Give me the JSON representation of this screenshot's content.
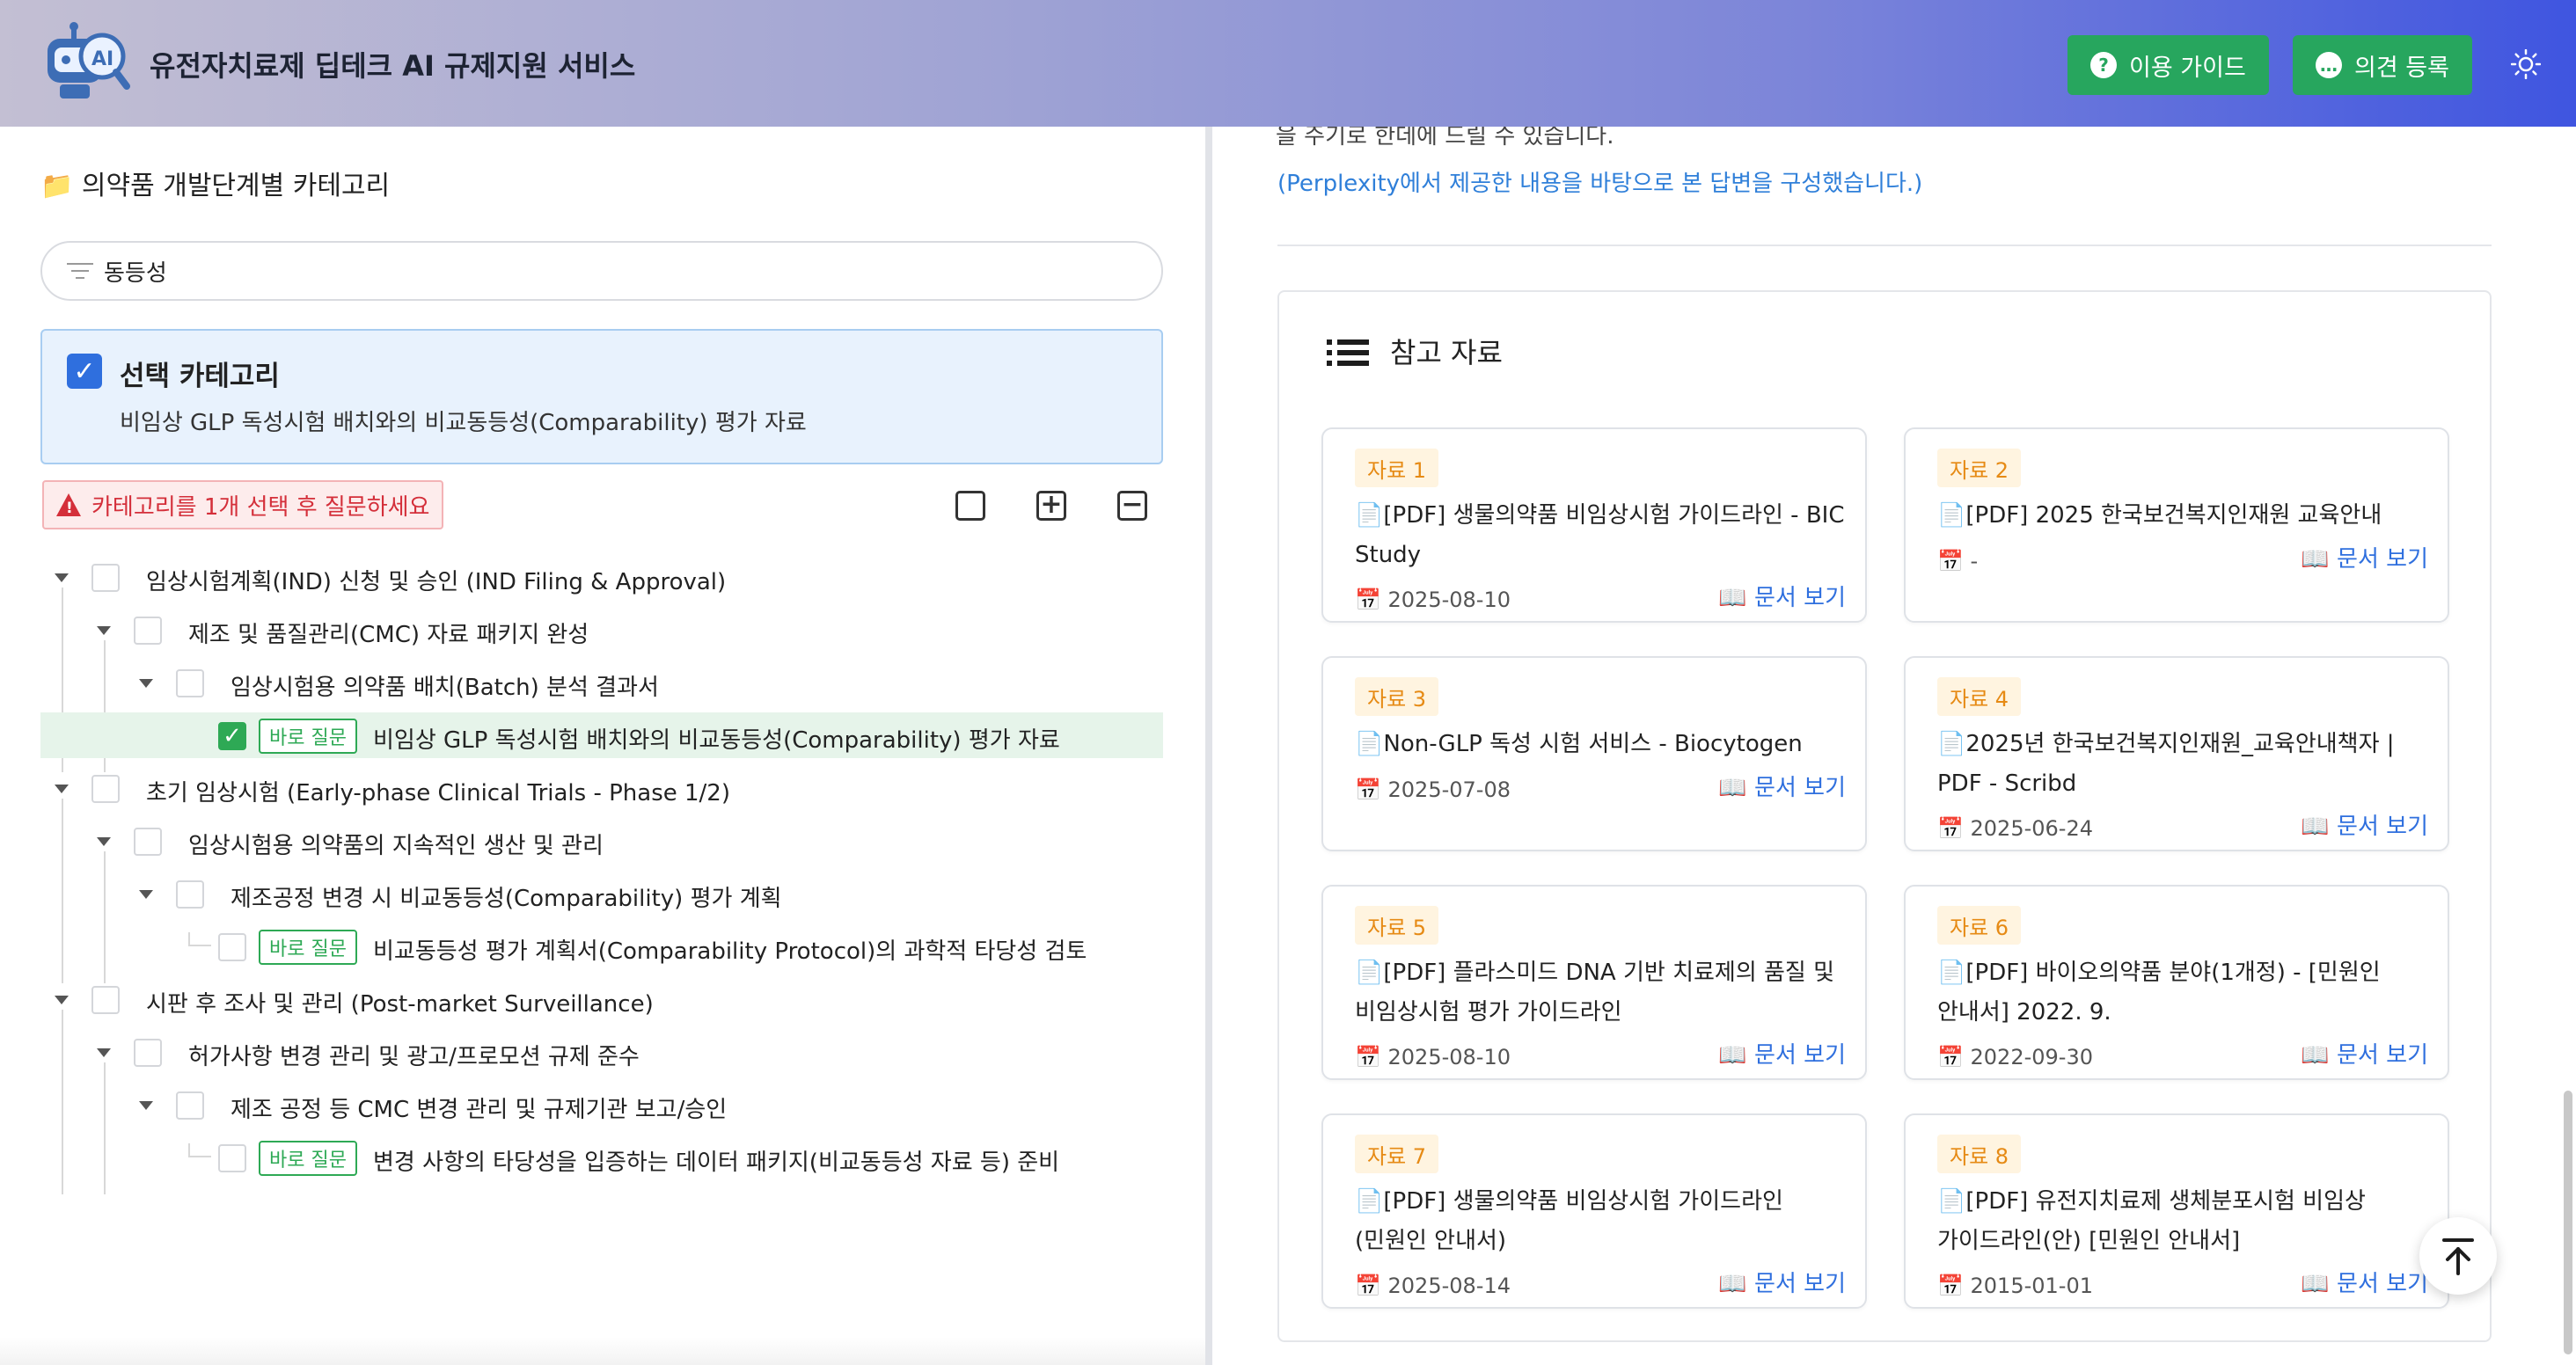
{
  "header": {
    "title": "유전자치료제 딥테크 AI 규제지원 서비스",
    "guide_label": "이용 가이드",
    "feedback_label": "의견 등록",
    "accent": "#27a65e"
  },
  "left": {
    "category_heading": "📁 의약품 개발단계별 카테고리",
    "filter_value": "동등성",
    "selected_title": "선택 카테고리",
    "selected_desc": "비임상 GLP 독성시험 배치와의 비교동등성(Comparability) 평가 자료",
    "warning": "카테고리를 1개 선택 후 질문하세요",
    "quick_tag": "바로 질문",
    "tree": [
      {
        "label": "임상시험계획(IND) 신청 및 승인 (IND Filing & Approval)"
      },
      {
        "label": "제조 및 품질관리(CMC) 자료 패키지 완성"
      },
      {
        "label": "임상시험용 의약품 배치(Batch) 분석 결과서"
      },
      {
        "label": "비임상 GLP 독성시험 배치와의 비교동등성(Comparability) 평가 자료",
        "checked": true
      },
      {
        "label": "초기 임상시험 (Early-phase Clinical Trials - Phase 1/2)"
      },
      {
        "label": "임상시험용 의약품의 지속적인 생산 및 관리"
      },
      {
        "label": "제조공정 변경 시 비교동등성(Comparability) 평가 계획"
      },
      {
        "label": "비교동등성 평가 계획서(Comparability Protocol)의 과학적 타당성 검토"
      },
      {
        "label": "시판 후 조사 및 관리 (Post-market Surveillance)"
      },
      {
        "label": "허가사항 변경 관리 및 광고/프로모션 규제 준수"
      },
      {
        "label": "제조 공정 등 CMC 변경 관리 및 규제기관 보고/승인"
      },
      {
        "label": "변경 사항의 타당성을 입증하는 데이터 패키지(비교동등성 자료 등) 준비"
      }
    ]
  },
  "right": {
    "partial_text": "을 주기로 한데에 드릴 수 있습니다.",
    "perplexity_note": "(Perplexity에서 제공한 내용을 바탕으로 본 답변을 구성했습니다.)",
    "ref_title": "참고 자료",
    "doc_link": "📖 문서 보기",
    "refs": [
      {
        "badge": "자료 1",
        "title": "📄[PDF] 생물의약품 비임상시험 가이드라인 - BIC Study",
        "date": "📅 2025-08-10"
      },
      {
        "badge": "자료 2",
        "title": "📄[PDF] 2025 한국보건복지인재원 교육안내",
        "date": "📅 -"
      },
      {
        "badge": "자료 3",
        "title": "📄Non-GLP 독성 시험 서비스 - Biocytogen",
        "date": "📅 2025-07-08"
      },
      {
        "badge": "자료 4",
        "title": "📄2025년 한국보건복지인재원_교육안내책자 | PDF - Scribd",
        "date": "📅 2025-06-24"
      },
      {
        "badge": "자료 5",
        "title": "📄[PDF] 플라스미드 DNA 기반 치료제의 품질 및 비임상시험 평가 가이드라인",
        "date": "📅 2025-08-10"
      },
      {
        "badge": "자료 6",
        "title": "📄[PDF] 바이오의약품 분야(1개정) - [민원인 안내서] 2022. 9.",
        "date": "📅 2022-09-30"
      },
      {
        "badge": "자료 7",
        "title": "📄[PDF] 생물의약품 비임상시험 가이드라인 (민원인 안내서)",
        "date": "📅 2025-08-14"
      },
      {
        "badge": "자료 8",
        "title": "📄[PDF] 유전지치료제 생체분포시험 비임상 가이드라인(안) [민원인 안내서]",
        "date": "📅 2015-01-01"
      }
    ]
  }
}
